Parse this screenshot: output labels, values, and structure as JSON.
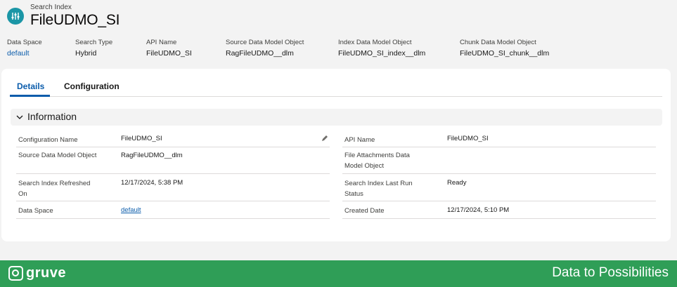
{
  "header": {
    "subtitle": "Search Index",
    "title": "FileUDMO_SI",
    "icon": "search-index-icon",
    "fields": [
      {
        "label": "Data Space",
        "value": "default"
      },
      {
        "label": "Search Type",
        "value": "Hybrid"
      },
      {
        "label": "API Name",
        "value": "FileUDMO_SI"
      },
      {
        "label": "Source Data Model Object",
        "value": "RagFileUDMO__dlm"
      },
      {
        "label": "Index Data Model Object",
        "value": "FileUDMO_SI_index__dlm"
      },
      {
        "label": "Chunk Data Model Object",
        "value": "FileUDMO_SI_chunk__dlm"
      }
    ]
  },
  "tabs": [
    {
      "label": "Details"
    },
    {
      "label": "Configuration"
    }
  ],
  "section": {
    "title": "Information"
  },
  "details": {
    "left": [
      {
        "label": "Configuration Name",
        "value": "FileUDMO_SI"
      },
      {
        "label": "Source Data Model Object",
        "value": "RagFileUDMO__dlm"
      },
      {
        "label1": "Search Index Refreshed",
        "label2": "On",
        "value": "12/17/2024, 5:38 PM"
      },
      {
        "label": "Data Space",
        "value": "default"
      }
    ],
    "right": [
      {
        "label": "API Name",
        "value": "FileUDMO_SI"
      },
      {
        "label1": "File Attachments Data",
        "label2": "Model Object",
        "value": ""
      },
      {
        "label1": "Search Index Last Run",
        "label2": "Status",
        "value": "Ready"
      },
      {
        "label": "Created Date",
        "value": "12/17/2024, 5:10 PM"
      }
    ]
  },
  "footer": {
    "logo_text": "gruve",
    "tagline": "Data to Possibilities"
  },
  "colors": {
    "brand_blue": "#0b5cab",
    "icon_teal": "#1b96a6",
    "footer_green": "#2f9e57"
  }
}
